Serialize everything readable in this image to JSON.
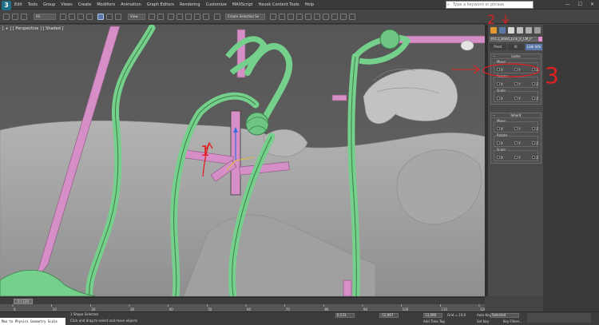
{
  "app": {
    "logo": "3"
  },
  "menu": [
    "Edit",
    "Tools",
    "Group",
    "Views",
    "Create",
    "Modifiers",
    "Animation",
    "Graph Editors",
    "Rendering",
    "Customize",
    "MAXScript",
    "Havok Content Tools",
    "Help"
  ],
  "search": {
    "placeholder": "Type a keyword or phrase",
    "icon": "search-icon"
  },
  "window_controls": {
    "minimize": "—",
    "maximize": "☐",
    "close": "✕"
  },
  "toolbar": {
    "selection_filter": "All",
    "view_dropdown": "View",
    "named_selection": "Create Selection Se"
  },
  "viewport": {
    "label": "[ + ] [ Perspective ] [ Shaded ]"
  },
  "annotations": {
    "one": "1",
    "two": "2",
    "three": "3"
  },
  "command_panel": {
    "object_name": "RFC1_Hand_Link_R_CM_P",
    "tabs": [
      "Pivot",
      "IK",
      "Link Info"
    ],
    "active_tab": "Link Info",
    "locks": {
      "title": "Locks",
      "groups": [
        {
          "label": "Move:",
          "axes": [
            "X",
            "Y",
            "Z"
          ]
        },
        {
          "label": "Rotate:",
          "axes": [
            "X",
            "Y",
            "Z"
          ]
        },
        {
          "label": "Scale:",
          "axes": [
            "X",
            "Y",
            "Z"
          ]
        }
      ]
    },
    "inherit": {
      "title": "Inherit",
      "groups": [
        {
          "label": "Move:",
          "axes": [
            "X",
            "Y",
            "Z"
          ]
        },
        {
          "label": "Rotate:",
          "axes": [
            "X",
            "Y",
            "Z"
          ]
        },
        {
          "label": "Scale:",
          "axes": [
            "X",
            "Y",
            "Z"
          ]
        }
      ]
    }
  },
  "timeline": {
    "frame_counter": "0 / 120",
    "ticks": [
      "0",
      "10",
      "20",
      "30",
      "40",
      "50",
      "60",
      "70",
      "80",
      "90",
      "100",
      "110",
      "120"
    ]
  },
  "status": {
    "listener": "Max to Physics Geometry Scale",
    "selection": "1 Shape Selected",
    "prompt": "Click and drag to select and move objects",
    "x": "6,533",
    "y": "-12,967",
    "z": "13,498",
    "grid": "Grid = 10,0",
    "add_time_tag": "Add Time Tag",
    "auto_key": "Auto Key",
    "selected": "Selected",
    "set_key": "Set Key",
    "key_filters": "Key Filters..."
  },
  "colors": {
    "accent": "#5b79a8",
    "pink": "#e38ecf",
    "green": "#7ad68c",
    "annotation": "#e02020"
  }
}
